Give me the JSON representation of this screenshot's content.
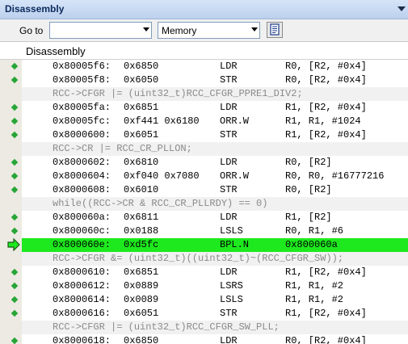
{
  "window": {
    "title": "Disassembly"
  },
  "toolbar": {
    "goto_label": "Go to",
    "goto_value": "",
    "memory_select": "Memory"
  },
  "header": {
    "label": "Disassembly"
  },
  "colors": {
    "current_line": "#1ee91e",
    "marker": "#27a536",
    "source_text": "#8a8a8a"
  },
  "icons": {
    "marker": "breakpoint-marker-icon",
    "current": "current-instruction-arrow-icon",
    "mem_btn": "memory-window-icon"
  },
  "rows": [
    {
      "kind": "asm",
      "marker": true,
      "addr": "0x80005f6:",
      "op": "0x6850",
      "mn": "LDR",
      "args": "R0, [R2, #0x4]"
    },
    {
      "kind": "asm",
      "marker": true,
      "addr": "0x80005f8:",
      "op": "0x6050",
      "mn": "STR",
      "args": "R0, [R2, #0x4]"
    },
    {
      "kind": "src",
      "text": "RCC->CFGR |= (uint32_t)RCC_CFGR_PPRE1_DIV2;"
    },
    {
      "kind": "asm",
      "marker": true,
      "addr": "0x80005fa:",
      "op": "0x6851",
      "mn": "LDR",
      "args": "R1, [R2, #0x4]"
    },
    {
      "kind": "asm",
      "marker": true,
      "addr": "0x80005fc:",
      "op": "0xf441 0x6180",
      "mn": "ORR.W",
      "args": "R1, R1, #1024"
    },
    {
      "kind": "asm",
      "marker": true,
      "addr": "0x8000600:",
      "op": "0x6051",
      "mn": "STR",
      "args": "R1, [R2, #0x4]"
    },
    {
      "kind": "src",
      "text": "RCC->CR |= RCC_CR_PLLON;"
    },
    {
      "kind": "asm",
      "marker": true,
      "addr": "0x8000602:",
      "op": "0x6810",
      "mn": "LDR",
      "args": "R0, [R2]"
    },
    {
      "kind": "asm",
      "marker": true,
      "addr": "0x8000604:",
      "op": "0xf040 0x7080",
      "mn": "ORR.W",
      "args": "R0, R0, #16777216"
    },
    {
      "kind": "asm",
      "marker": true,
      "addr": "0x8000608:",
      "op": "0x6010",
      "mn": "STR",
      "args": "R0, [R2]"
    },
    {
      "kind": "src",
      "text": "while((RCC->CR & RCC_CR_PLLRDY) == 0)"
    },
    {
      "kind": "asm",
      "marker": true,
      "addr": "0x800060a:",
      "op": "0x6811",
      "mn": "LDR",
      "args": "R1, [R2]"
    },
    {
      "kind": "asm",
      "marker": true,
      "addr": "0x800060c:",
      "op": "0x0188",
      "mn": "LSLS",
      "args": "R0, R1, #6"
    },
    {
      "kind": "cur",
      "marker": false,
      "addr": "0x800060e:",
      "op": "0xd5fc",
      "mn": "BPL.N",
      "args": "0x800060a"
    },
    {
      "kind": "src",
      "text": "RCC->CFGR &= (uint32_t)((uint32_t)~(RCC_CFGR_SW));"
    },
    {
      "kind": "asm",
      "marker": true,
      "addr": "0x8000610:",
      "op": "0x6851",
      "mn": "LDR",
      "args": "R1, [R2, #0x4]"
    },
    {
      "kind": "asm",
      "marker": true,
      "addr": "0x8000612:",
      "op": "0x0889",
      "mn": "LSRS",
      "args": "R1, R1, #2"
    },
    {
      "kind": "asm",
      "marker": true,
      "addr": "0x8000614:",
      "op": "0x0089",
      "mn": "LSLS",
      "args": "R1, R1, #2"
    },
    {
      "kind": "asm",
      "marker": true,
      "addr": "0x8000616:",
      "op": "0x6051",
      "mn": "STR",
      "args": "R1, [R2, #0x4]"
    },
    {
      "kind": "src",
      "text": "RCC->CFGR |= (uint32_t)RCC_CFGR_SW_PLL;"
    },
    {
      "kind": "asm",
      "marker": true,
      "addr": "0x8000618:",
      "op": "0x6850",
      "mn": "LDR",
      "args": "R0, [R2, #0x4]"
    }
  ]
}
